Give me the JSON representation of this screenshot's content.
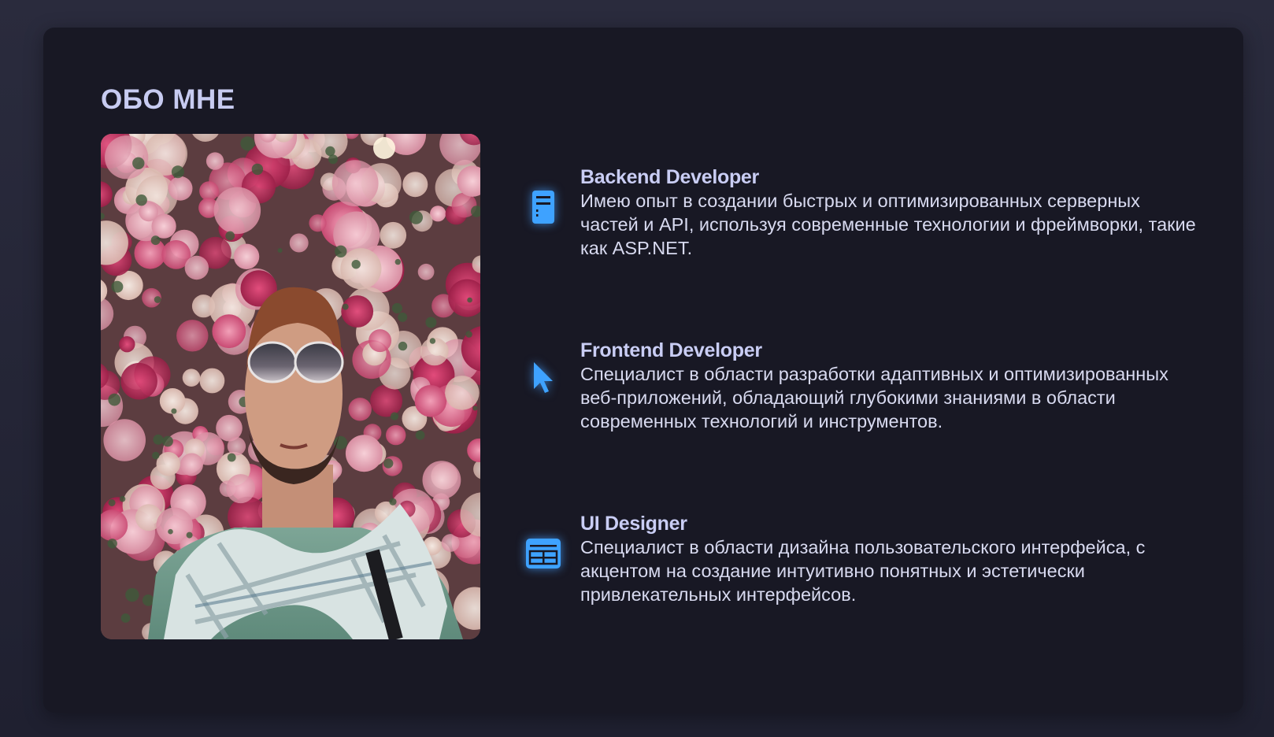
{
  "about": {
    "title": "ОБО МНЕ",
    "photo_alt": "Фото",
    "skills": [
      {
        "icon": "server-icon",
        "title": "Backend Developer",
        "description": "Имею опыт в создании быстрых и оптимизированных серверных частей и API, используя современные технологии и фреймворки, такие как ASP.NET."
      },
      {
        "icon": "cursor-icon",
        "title": "Frontend Developer",
        "description": "Специалист в области разработки адаптивных и оптимизированных веб-приложений, обладающий глубокими знаниями в области современных технологий и инструментов."
      },
      {
        "icon": "layout-icon",
        "title": "UI Designer",
        "description": "Специалист в области дизайна пользовательского интерфейса, с акцентом на создание интуитивно понятных и эстетически привлекательных интерфейсов."
      }
    ]
  },
  "colors": {
    "page_background": "#23243a",
    "card_background": "#181824",
    "title": "#c7cbf1",
    "text": "#d8daf0",
    "accent": "#3ea2ff"
  }
}
